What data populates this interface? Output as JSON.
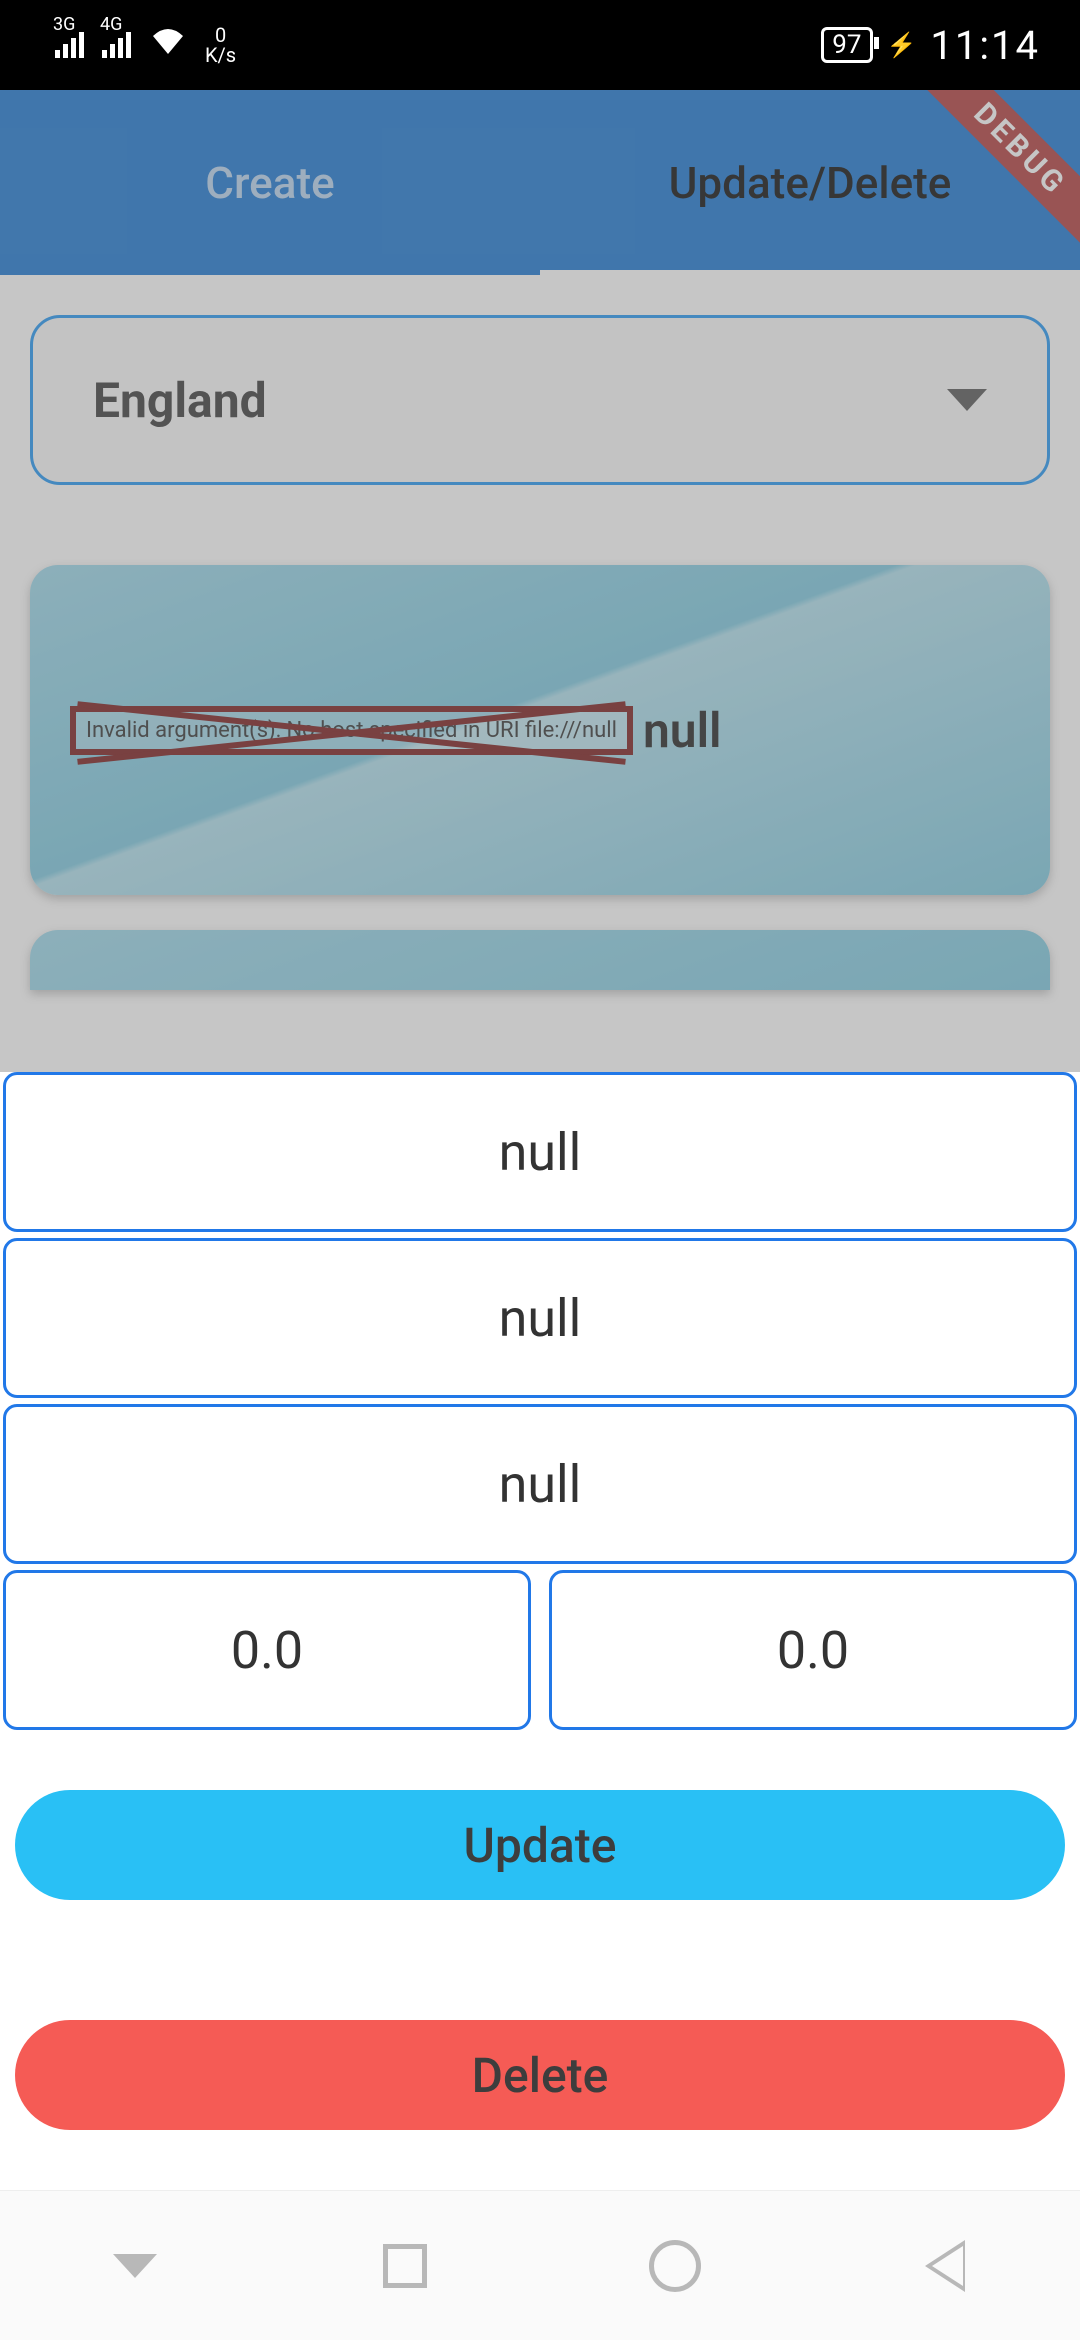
{
  "status": {
    "net1": "3G",
    "net2": "4G",
    "data_rate_top": "0",
    "data_rate_bottom": "K/s",
    "battery": "97",
    "time": "11:14"
  },
  "debug_ribbon": "DEBUG",
  "tabs": {
    "create": "Create",
    "update_delete": "Update/Delete"
  },
  "dropdown": {
    "selected": "England"
  },
  "card": {
    "error_text": "Invalid argument(s): No host specified in URI file:///null",
    "title": "null"
  },
  "sheet": {
    "fields": [
      "null",
      "null",
      "null"
    ],
    "num_left": "0.0",
    "num_right": "0.0",
    "update_label": "Update",
    "delete_label": "Delete"
  }
}
